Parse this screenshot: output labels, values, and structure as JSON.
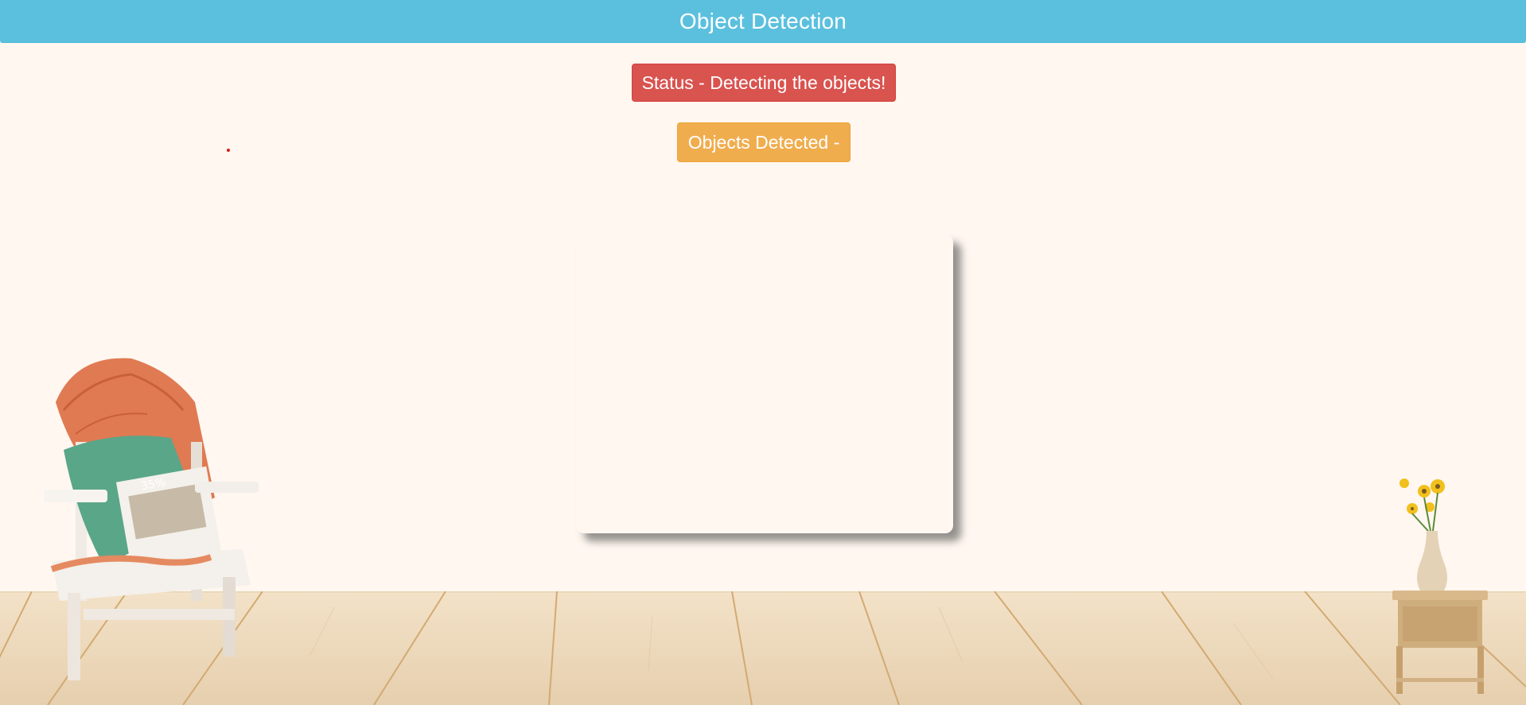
{
  "navbar": {
    "title": "Object Detection"
  },
  "status": {
    "label": "Status - Detecting the objects!"
  },
  "detected": {
    "label": "Objects Detected -"
  },
  "colors": {
    "navbar": "#5bc0de",
    "status": "#d9534f",
    "detected": "#f0ad4e",
    "background": "#fff7f0"
  }
}
